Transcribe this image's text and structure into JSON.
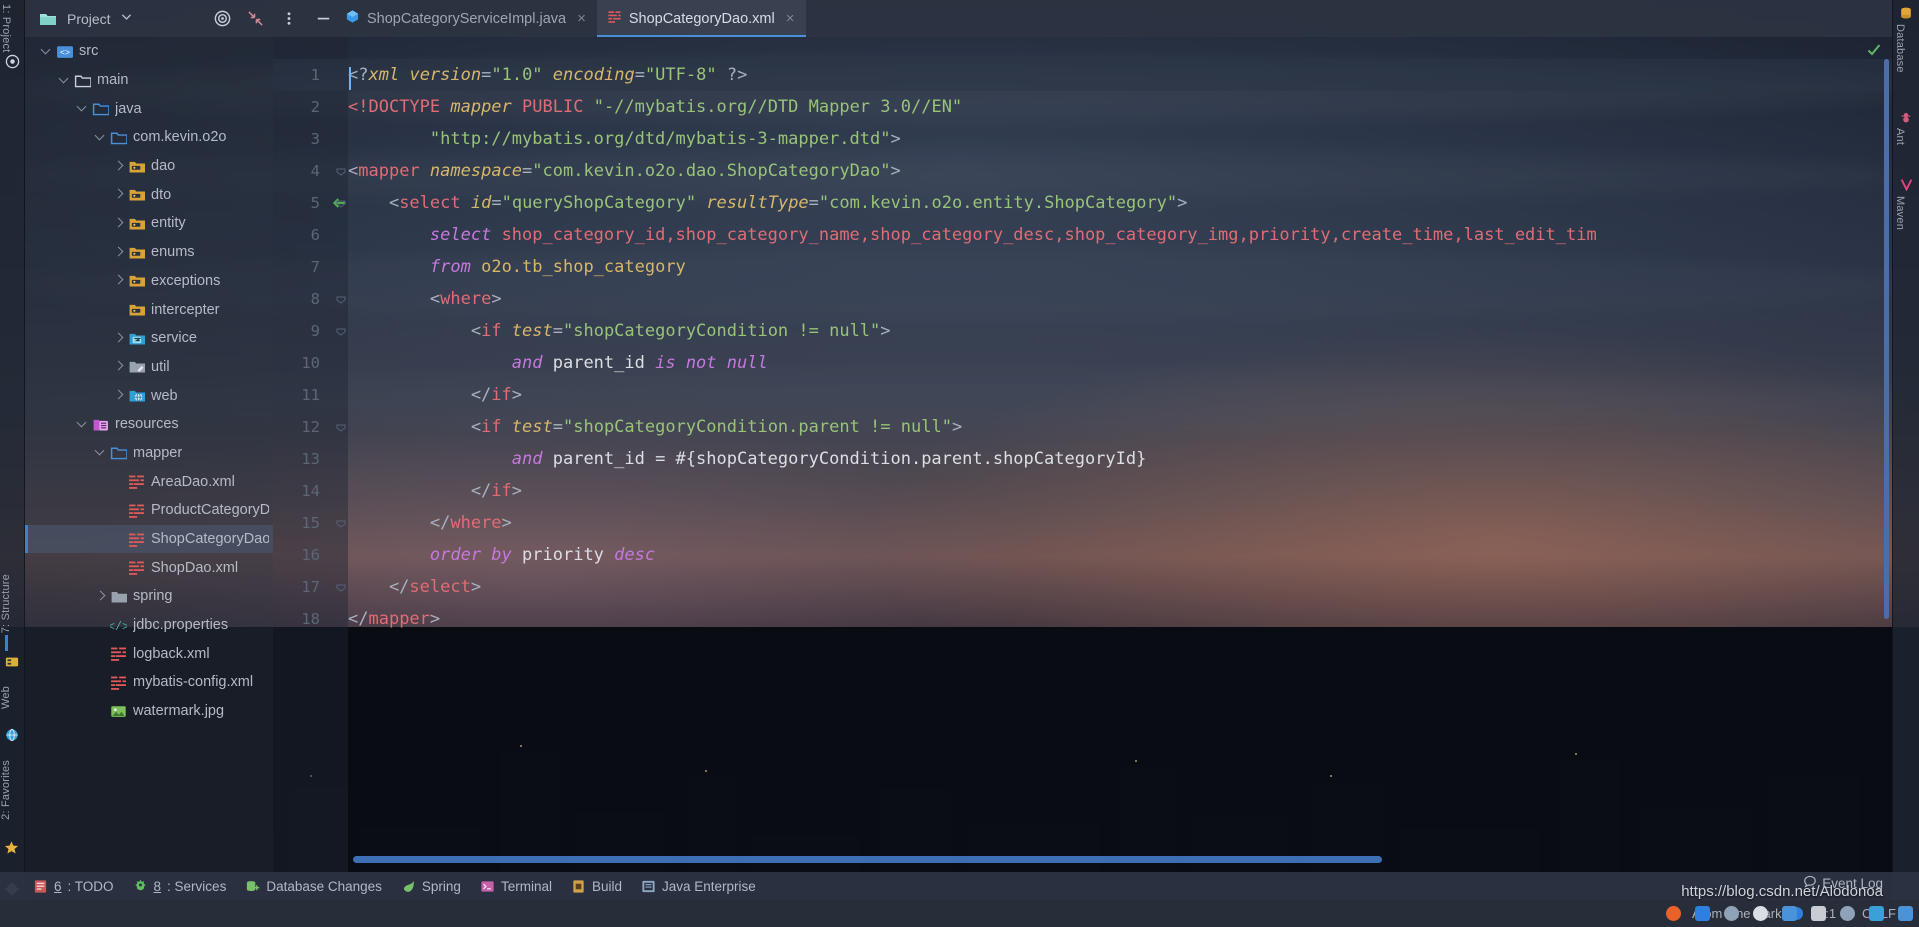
{
  "app": {
    "theme_name": "Atom One Dark",
    "accent_blue": "#4a8ed8",
    "selection_bg": "#475164"
  },
  "left_strip": {
    "items": [
      {
        "label": "1: Project",
        "icon": "project-icon",
        "active": true
      },
      {
        "label": "7: Structure",
        "icon": "structure-icon",
        "active": false
      },
      {
        "label": "Web",
        "icon": "web-icon",
        "active": false
      },
      {
        "label": "2: Favorites",
        "icon": "star-icon",
        "active": false
      }
    ]
  },
  "right_strip": {
    "items": [
      {
        "label": "Database",
        "icon": "database-icon"
      },
      {
        "label": "Ant",
        "icon": "ant-icon"
      },
      {
        "label": "Maven",
        "icon": "maven-icon"
      }
    ]
  },
  "toolbar": {
    "project_label": "Project",
    "chevron": "chevron-down-icon",
    "locate_label": "locate-icon",
    "collapse_label": "collapse-all-icon",
    "options_label": "options-menu-icon",
    "hide_label": "hide-icon"
  },
  "tabs": [
    {
      "label": "ShopCategoryServiceImpl.java",
      "icon": "java-class-icon",
      "active": false,
      "close": "×"
    },
    {
      "label": "ShopCategoryDao.xml",
      "icon": "xml-file-icon",
      "active": true,
      "close": "×"
    }
  ],
  "project_tree": [
    {
      "label": "src",
      "depth": 0,
      "arrow": "down",
      "icon": "source-root-icon",
      "selected": false
    },
    {
      "label": "main",
      "depth": 1,
      "arrow": "down",
      "icon": "folder-plain-icon",
      "selected": false
    },
    {
      "label": "java",
      "depth": 2,
      "arrow": "down",
      "icon": "folder-blue-icon",
      "selected": false
    },
    {
      "label": "com.kevin.o2o",
      "depth": 3,
      "arrow": "down",
      "icon": "folder-blue-icon",
      "selected": false
    },
    {
      "label": "dao",
      "depth": 4,
      "arrow": "right",
      "icon": "folder-pkg-icon",
      "selected": false
    },
    {
      "label": "dto",
      "depth": 4,
      "arrow": "right",
      "icon": "folder-pkg-icon",
      "selected": false
    },
    {
      "label": "entity",
      "depth": 4,
      "arrow": "right",
      "icon": "folder-pkg-icon",
      "selected": false
    },
    {
      "label": "enums",
      "depth": 4,
      "arrow": "right",
      "icon": "folder-pkg-icon",
      "selected": false
    },
    {
      "label": "exceptions",
      "depth": 4,
      "arrow": "right",
      "icon": "folder-pkg-icon",
      "selected": false
    },
    {
      "label": "intercepter",
      "depth": 4,
      "arrow": "none",
      "icon": "folder-pkg-icon",
      "selected": false
    },
    {
      "label": "service",
      "depth": 4,
      "arrow": "right",
      "icon": "folder-service-icon",
      "selected": false
    },
    {
      "label": "util",
      "depth": 4,
      "arrow": "right",
      "icon": "folder-util-icon",
      "selected": false
    },
    {
      "label": "web",
      "depth": 4,
      "arrow": "right",
      "icon": "folder-web-icon",
      "selected": false
    },
    {
      "label": "resources",
      "depth": 2,
      "arrow": "down",
      "icon": "resource-root-icon",
      "selected": false
    },
    {
      "label": "mapper",
      "depth": 3,
      "arrow": "down",
      "icon": "folder-blue-icon",
      "selected": false
    },
    {
      "label": "AreaDao.xml",
      "depth": 4,
      "arrow": "none",
      "icon": "xml-file-icon",
      "selected": false
    },
    {
      "label": "ProductCategoryDao.xml",
      "depth": 4,
      "arrow": "none",
      "icon": "xml-file-icon",
      "selected": false
    },
    {
      "label": "ShopCategoryDao.xml",
      "depth": 4,
      "arrow": "none",
      "icon": "xml-file-icon",
      "selected": true
    },
    {
      "label": "ShopDao.xml",
      "depth": 4,
      "arrow": "none",
      "icon": "xml-file-icon",
      "selected": false
    },
    {
      "label": "spring",
      "depth": 3,
      "arrow": "right",
      "icon": "folder-grey-icon",
      "selected": false
    },
    {
      "label": "jdbc.properties",
      "depth": 3,
      "arrow": "none",
      "icon": "properties-icon",
      "selected": false
    },
    {
      "label": "logback.xml",
      "depth": 3,
      "arrow": "none",
      "icon": "xml-file-icon",
      "selected": false
    },
    {
      "label": "mybatis-config.xml",
      "depth": 3,
      "arrow": "none",
      "icon": "xml-file-icon",
      "selected": false
    },
    {
      "label": "watermark.jpg",
      "depth": 3,
      "arrow": "none",
      "icon": "image-file-icon",
      "selected": false
    }
  ],
  "editor": {
    "file": "ShopCategoryDao.xml",
    "cursor_position": "1:1",
    "line_separator": "CRLF",
    "gutter_marker_line": 5,
    "gutter_marker_icon": "green-left-arrow-icon",
    "inspection_status": "inspections-ok-icon",
    "lines": [
      {
        "no": 1,
        "tokens": [
          {
            "t": "<?",
            "c": "s-punct"
          },
          {
            "t": "xml",
            "c": "s-attr"
          },
          {
            "t": " ",
            "c": "s-plain"
          },
          {
            "t": "version",
            "c": "s-attr"
          },
          {
            "t": "=",
            "c": "s-punct"
          },
          {
            "t": "\"1.0\"",
            "c": "s-str"
          },
          {
            "t": " ",
            "c": "s-plain"
          },
          {
            "t": "encoding",
            "c": "s-attr"
          },
          {
            "t": "=",
            "c": "s-punct"
          },
          {
            "t": "\"UTF-8\"",
            "c": "s-str"
          },
          {
            "t": " ?>",
            "c": "s-punct"
          }
        ]
      },
      {
        "no": 2,
        "tokens": [
          {
            "t": "<!DOCTYPE ",
            "c": "s-doctype"
          },
          {
            "t": "mapper",
            "c": "s-attr"
          },
          {
            "t": " ",
            "c": "s-plain"
          },
          {
            "t": "PUBLIC",
            "c": "s-doctype"
          },
          {
            "t": " ",
            "c": "s-plain"
          },
          {
            "t": "\"-//mybatis.org//DTD Mapper 3.0//EN\"",
            "c": "s-str"
          }
        ]
      },
      {
        "no": 3,
        "tokens": [
          {
            "t": "        ",
            "c": "s-plain"
          },
          {
            "t": "\"http://mybatis.org/dtd/mybatis-3-mapper.dtd\"",
            "c": "s-str"
          },
          {
            "t": ">",
            "c": "s-punct"
          }
        ]
      },
      {
        "no": 4,
        "tokens": [
          {
            "t": "<",
            "c": "s-punct"
          },
          {
            "t": "mapper",
            "c": "s-tag"
          },
          {
            "t": " ",
            "c": "s-plain"
          },
          {
            "t": "namespace",
            "c": "s-attr"
          },
          {
            "t": "=",
            "c": "s-punct"
          },
          {
            "t": "\"com.kevin.o2o.dao.ShopCategoryDao\"",
            "c": "s-str"
          },
          {
            "t": ">",
            "c": "s-punct"
          }
        ]
      },
      {
        "no": 5,
        "tokens": [
          {
            "t": "    <",
            "c": "s-punct"
          },
          {
            "t": "select",
            "c": "s-tag"
          },
          {
            "t": " ",
            "c": "s-plain"
          },
          {
            "t": "id",
            "c": "s-attr"
          },
          {
            "t": "=",
            "c": "s-punct"
          },
          {
            "t": "\"queryShopCategory\"",
            "c": "s-str"
          },
          {
            "t": " ",
            "c": "s-plain"
          },
          {
            "t": "resultType",
            "c": "s-attr"
          },
          {
            "t": "=",
            "c": "s-punct"
          },
          {
            "t": "\"com.kevin.o2o.entity.ShopCategory\"",
            "c": "s-str"
          },
          {
            "t": ">",
            "c": "s-punct"
          }
        ]
      },
      {
        "no": 6,
        "tokens": [
          {
            "t": "        ",
            "c": "s-plain"
          },
          {
            "t": "select",
            "c": "s-kw"
          },
          {
            "t": " ",
            "c": "s-plain"
          },
          {
            "t": "shop_category_id,shop_category_name,shop_category_desc,shop_category_img,priority,create_time,last_edit_tim",
            "c": "s-sqlid"
          }
        ]
      },
      {
        "no": 7,
        "tokens": [
          {
            "t": "        ",
            "c": "s-plain"
          },
          {
            "t": "from",
            "c": "s-kw"
          },
          {
            "t": " ",
            "c": "s-plain"
          },
          {
            "t": "o2o.tb_shop_category",
            "c": "s-tblname"
          }
        ]
      },
      {
        "no": 8,
        "tokens": [
          {
            "t": "        <",
            "c": "s-punct"
          },
          {
            "t": "where",
            "c": "s-tag"
          },
          {
            "t": ">",
            "c": "s-punct"
          }
        ]
      },
      {
        "no": 9,
        "tokens": [
          {
            "t": "            <",
            "c": "s-punct"
          },
          {
            "t": "if",
            "c": "s-tag"
          },
          {
            "t": " ",
            "c": "s-plain"
          },
          {
            "t": "test",
            "c": "s-attr"
          },
          {
            "t": "=",
            "c": "s-punct"
          },
          {
            "t": "\"shopCategoryCondition != null\"",
            "c": "s-str"
          },
          {
            "t": ">",
            "c": "s-punct"
          }
        ]
      },
      {
        "no": 10,
        "tokens": [
          {
            "t": "                ",
            "c": "s-plain"
          },
          {
            "t": "and",
            "c": "s-kw"
          },
          {
            "t": " ",
            "c": "s-plain"
          },
          {
            "t": "parent_id",
            "c": "s-ident"
          },
          {
            "t": " ",
            "c": "s-plain"
          },
          {
            "t": "is not null",
            "c": "s-kw"
          }
        ]
      },
      {
        "no": 11,
        "tokens": [
          {
            "t": "            </",
            "c": "s-punct"
          },
          {
            "t": "if",
            "c": "s-tag"
          },
          {
            "t": ">",
            "c": "s-punct"
          }
        ]
      },
      {
        "no": 12,
        "tokens": [
          {
            "t": "            <",
            "c": "s-punct"
          },
          {
            "t": "if",
            "c": "s-tag"
          },
          {
            "t": " ",
            "c": "s-plain"
          },
          {
            "t": "test",
            "c": "s-attr"
          },
          {
            "t": "=",
            "c": "s-punct"
          },
          {
            "t": "\"shopCategoryCondition.parent != null\"",
            "c": "s-str"
          },
          {
            "t": ">",
            "c": "s-punct"
          }
        ]
      },
      {
        "no": 13,
        "tokens": [
          {
            "t": "                ",
            "c": "s-plain"
          },
          {
            "t": "and",
            "c": "s-kw"
          },
          {
            "t": " ",
            "c": "s-plain"
          },
          {
            "t": "parent_id = #{shopCategoryCondition.parent.shopCategoryId}",
            "c": "s-ident"
          }
        ]
      },
      {
        "no": 14,
        "tokens": [
          {
            "t": "            </",
            "c": "s-punct"
          },
          {
            "t": "if",
            "c": "s-tag"
          },
          {
            "t": ">",
            "c": "s-punct"
          }
        ]
      },
      {
        "no": 15,
        "tokens": [
          {
            "t": "        </",
            "c": "s-punct"
          },
          {
            "t": "where",
            "c": "s-tag"
          },
          {
            "t": ">",
            "c": "s-punct"
          }
        ]
      },
      {
        "no": 16,
        "tokens": [
          {
            "t": "        ",
            "c": "s-plain"
          },
          {
            "t": "order by",
            "c": "s-kw"
          },
          {
            "t": " ",
            "c": "s-plain"
          },
          {
            "t": "priority",
            "c": "s-ident"
          },
          {
            "t": " ",
            "c": "s-plain"
          },
          {
            "t": "desc",
            "c": "s-kw"
          }
        ]
      },
      {
        "no": 17,
        "tokens": [
          {
            "t": "    </",
            "c": "s-punct"
          },
          {
            "t": "select",
            "c": "s-tag"
          },
          {
            "t": ">",
            "c": "s-punct"
          }
        ]
      },
      {
        "no": 18,
        "tokens": [
          {
            "t": "</",
            "c": "s-punct"
          },
          {
            "t": "mapper",
            "c": "s-tag"
          },
          {
            "t": ">",
            "c": "s-punct"
          }
        ]
      }
    ]
  },
  "bottom_tools": [
    {
      "mnemonic": "6",
      "label": ": TODO",
      "icon": "todo-icon"
    },
    {
      "mnemonic": "8",
      "label": ": Services",
      "icon": "services-icon"
    },
    {
      "mnemonic": "",
      "label": "Database Changes",
      "icon": "database-changes-icon"
    },
    {
      "mnemonic": "",
      "label": "Spring",
      "icon": "spring-leaf-icon"
    },
    {
      "mnemonic": "",
      "label": "Terminal",
      "icon": "terminal-icon"
    },
    {
      "mnemonic": "",
      "label": "Build",
      "icon": "build-icon"
    },
    {
      "mnemonic": "",
      "label": "Java Enterprise",
      "icon": "java-enterprise-icon"
    }
  ],
  "status_bar": {
    "event_log": "Event Log",
    "event_log_icon": "balloon-icon",
    "theme": "Atom One Dark",
    "caret": "1:1",
    "line_sep": "CRLF"
  },
  "watermark": {
    "url": "https://blog.csdn.net/Alodonoa"
  }
}
